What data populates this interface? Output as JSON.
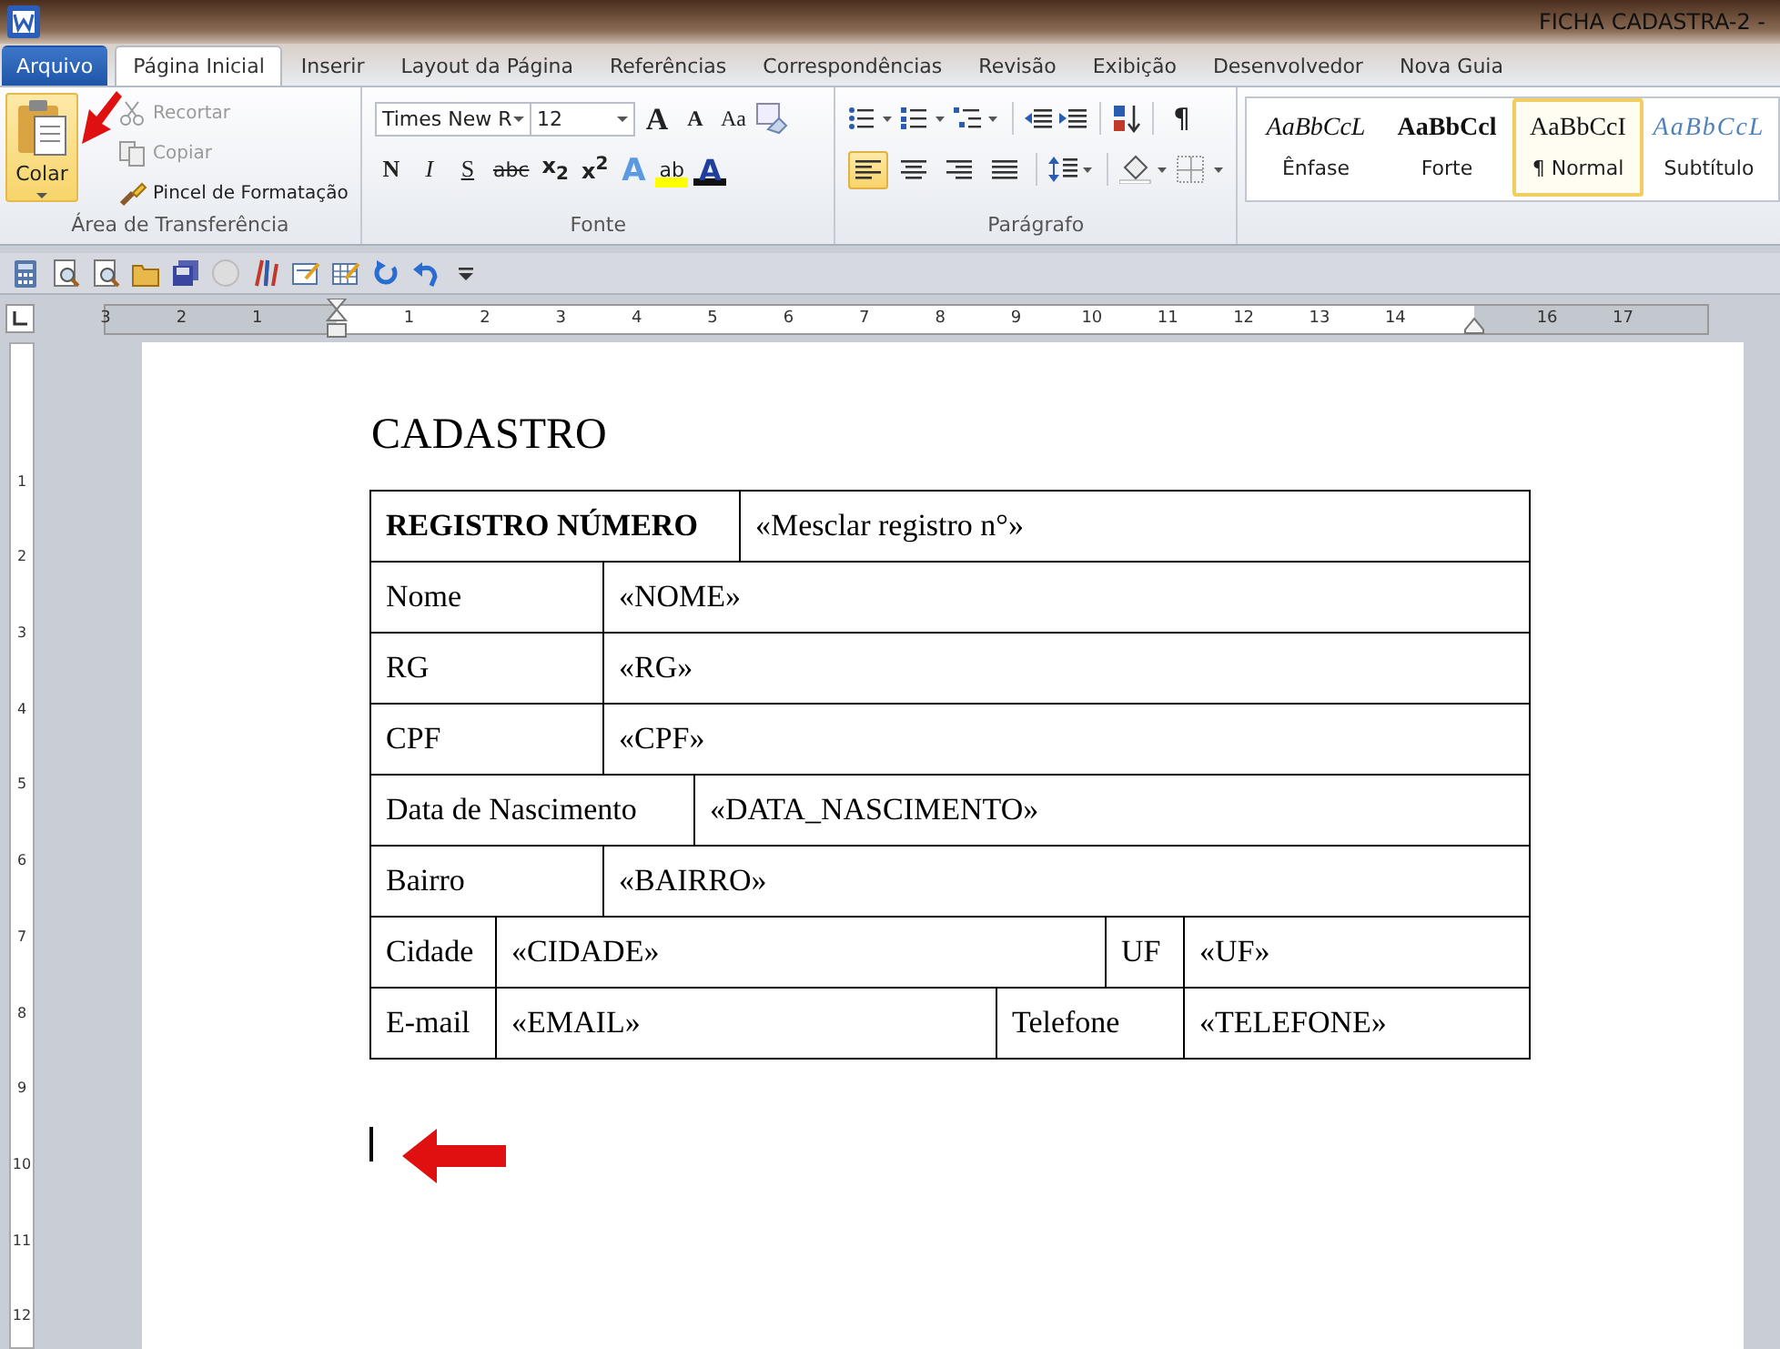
{
  "window": {
    "title": "FICHA CADASTRA-2 -"
  },
  "tabs": [
    {
      "label": "Arquivo",
      "kind": "file",
      "selected": false
    },
    {
      "label": "Página Inicial",
      "kind": "tab",
      "selected": true
    },
    {
      "label": "Inserir",
      "kind": "tab",
      "selected": false
    },
    {
      "label": "Layout da Página",
      "kind": "tab",
      "selected": false
    },
    {
      "label": "Referências",
      "kind": "tab",
      "selected": false
    },
    {
      "label": "Correspondências",
      "kind": "tab",
      "selected": false
    },
    {
      "label": "Revisão",
      "kind": "tab",
      "selected": false
    },
    {
      "label": "Exibição",
      "kind": "tab",
      "selected": false
    },
    {
      "label": "Desenvolvedor",
      "kind": "tab",
      "selected": false
    },
    {
      "label": "Nova Guia",
      "kind": "tab",
      "selected": false
    }
  ],
  "clipboard": {
    "paste": "Colar",
    "group_label": "Área de Transferência",
    "actions": [
      {
        "label": "Recortar",
        "kind": "cut",
        "disabled": true
      },
      {
        "label": "Copiar",
        "kind": "copy",
        "disabled": true
      },
      {
        "label": "Pincel de Formatação",
        "kind": "brush",
        "disabled": false
      }
    ]
  },
  "font": {
    "name": "Times New R",
    "size": "12",
    "group_label": "Fonte",
    "top_buttons": [
      {
        "label": "A",
        "kind": "grow"
      },
      {
        "label": "A",
        "kind": "shrink"
      },
      {
        "label": "Aa",
        "kind": "case"
      }
    ],
    "bottom_buttons": [
      {
        "label": "N",
        "kind": "bold"
      },
      {
        "label": "I",
        "kind": "italic"
      },
      {
        "label": "S",
        "kind": "underline"
      },
      {
        "label": "abc",
        "kind": "strike"
      },
      {
        "label": "x$_{2}$",
        "kind": "script"
      },
      {
        "label": "x$^{2}$",
        "kind": "script"
      },
      {
        "label": "A",
        "kind": "effects"
      },
      {
        "label": "ab",
        "kind": "highlight"
      },
      {
        "label": "A",
        "kind": "color"
      }
    ]
  },
  "paragraph": {
    "group_label": "Parágrafo",
    "pilcrow": "¶",
    "alignment": [
      {
        "kind": "left",
        "selected": true
      },
      {
        "kind": "center",
        "selected": false
      },
      {
        "kind": "right",
        "selected": false
      },
      {
        "kind": "justify",
        "selected": false
      }
    ]
  },
  "styles": [
    {
      "sample": "AaBbCcL",
      "label": "Ênfase",
      "kind": "emphasis",
      "selected": false
    },
    {
      "sample": "AaBbCcl",
      "label": "Forte",
      "kind": "strong",
      "selected": false
    },
    {
      "sample": "AaBbCcI",
      "label": "¶ Normal",
      "kind": "normal",
      "selected": true
    },
    {
      "sample": "AaBbCcL",
      "label": "Subtítulo",
      "kind": "subtitle",
      "selected": false
    }
  ],
  "ruler": {
    "left_labels": [
      "3",
      "2",
      "1"
    ],
    "right_labels": [
      "1",
      "2",
      "3",
      "4",
      "5",
      "6",
      "7",
      "8",
      "9",
      "10",
      "11",
      "12",
      "13",
      "14"
    ],
    "outer_labels": [
      "16",
      "17"
    ]
  },
  "vertical_ruler": {
    "labels": [
      "1",
      "2",
      "3",
      "4",
      "5",
      "6",
      "7",
      "8",
      "9",
      "10",
      "11",
      "12"
    ]
  },
  "document": {
    "heading": "CADASTRO",
    "rows": [
      {
        "cells": [
          {
            "text": "REGISTRO NÚMERO",
            "bold": true
          },
          {
            "text": "«Mesclar registro n°»",
            "bold": false
          }
        ]
      },
      {
        "cells": [
          {
            "text": "Nome",
            "bold": false
          },
          {
            "text": "«NOME»",
            "bold": false
          }
        ]
      },
      {
        "cells": [
          {
            "text": "RG",
            "bold": false
          },
          {
            "text": "«RG»",
            "bold": false
          }
        ]
      },
      {
        "cells": [
          {
            "text": "CPF",
            "bold": false
          },
          {
            "text": "«CPF»",
            "bold": false
          }
        ]
      },
      {
        "cells": [
          {
            "text": "Data de Nascimento",
            "bold": false
          },
          {
            "text": "«DATA_NASCIMENTO»",
            "bold": false
          }
        ]
      },
      {
        "cells": [
          {
            "text": "Bairro",
            "bold": false
          },
          {
            "text": "«BAIRRO»",
            "bold": false
          }
        ]
      },
      {
        "cells": [
          {
            "text": "Cidade",
            "bold": false
          },
          {
            "text": "«CIDADE»",
            "bold": false
          },
          {
            "text": "UF",
            "bold": false
          },
          {
            "text": "«UF»",
            "bold": false
          }
        ]
      },
      {
        "cells": [
          {
            "text": "E-mail",
            "bold": false
          },
          {
            "text": "«EMAIL»",
            "bold": false
          },
          {
            "text": "Telefone",
            "bold": false
          },
          {
            "text": "«TELEFONE»",
            "bold": false
          }
        ]
      }
    ]
  }
}
